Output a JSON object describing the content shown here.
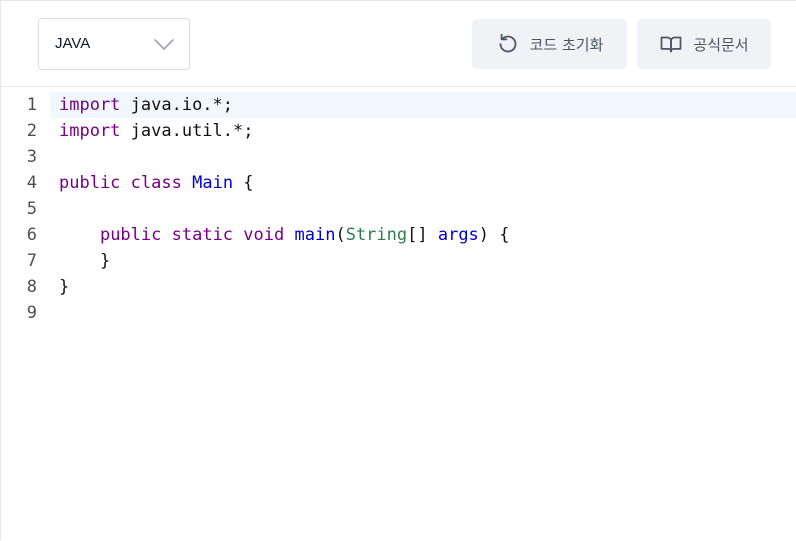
{
  "toolbar": {
    "language": "JAVA",
    "reset_label": "코드 초기화",
    "docs_label": "공식문서"
  },
  "icons": {
    "language_dropdown": "chevron-down-icon",
    "reset": "rotate-ccw-icon",
    "docs": "open-book-icon"
  },
  "colors": {
    "keyword": "#770088",
    "definition": "#0000cc",
    "type": "#2f7d4f",
    "active_line": "#f1f8fd"
  },
  "editor": {
    "active_line": 1,
    "lines": [
      {
        "number": "1",
        "tokens": [
          {
            "t": "kw",
            "v": "import"
          },
          {
            "t": "plain",
            "v": " java.io.*;"
          }
        ]
      },
      {
        "number": "2",
        "tokens": [
          {
            "t": "kw",
            "v": "import"
          },
          {
            "t": "plain",
            "v": " java.util.*;"
          }
        ]
      },
      {
        "number": "3",
        "tokens": []
      },
      {
        "number": "4",
        "tokens": [
          {
            "t": "kw",
            "v": "public"
          },
          {
            "t": "plain",
            "v": " "
          },
          {
            "t": "kw",
            "v": "class"
          },
          {
            "t": "plain",
            "v": " "
          },
          {
            "t": "def",
            "v": "Main"
          },
          {
            "t": "plain",
            "v": " {"
          }
        ]
      },
      {
        "number": "5",
        "tokens": []
      },
      {
        "number": "6",
        "tokens": [
          {
            "t": "plain",
            "v": "    "
          },
          {
            "t": "kw",
            "v": "public"
          },
          {
            "t": "plain",
            "v": " "
          },
          {
            "t": "kw",
            "v": "static"
          },
          {
            "t": "plain",
            "v": " "
          },
          {
            "t": "kw",
            "v": "void"
          },
          {
            "t": "plain",
            "v": " "
          },
          {
            "t": "def",
            "v": "main"
          },
          {
            "t": "plain",
            "v": "("
          },
          {
            "t": "type",
            "v": "String"
          },
          {
            "t": "plain",
            "v": "[] "
          },
          {
            "t": "var",
            "v": "args"
          },
          {
            "t": "plain",
            "v": ") {"
          }
        ]
      },
      {
        "number": "7",
        "tokens": [
          {
            "t": "plain",
            "v": "    }"
          }
        ]
      },
      {
        "number": "8",
        "tokens": [
          {
            "t": "plain",
            "v": "}"
          }
        ]
      },
      {
        "number": "9",
        "tokens": []
      }
    ]
  }
}
